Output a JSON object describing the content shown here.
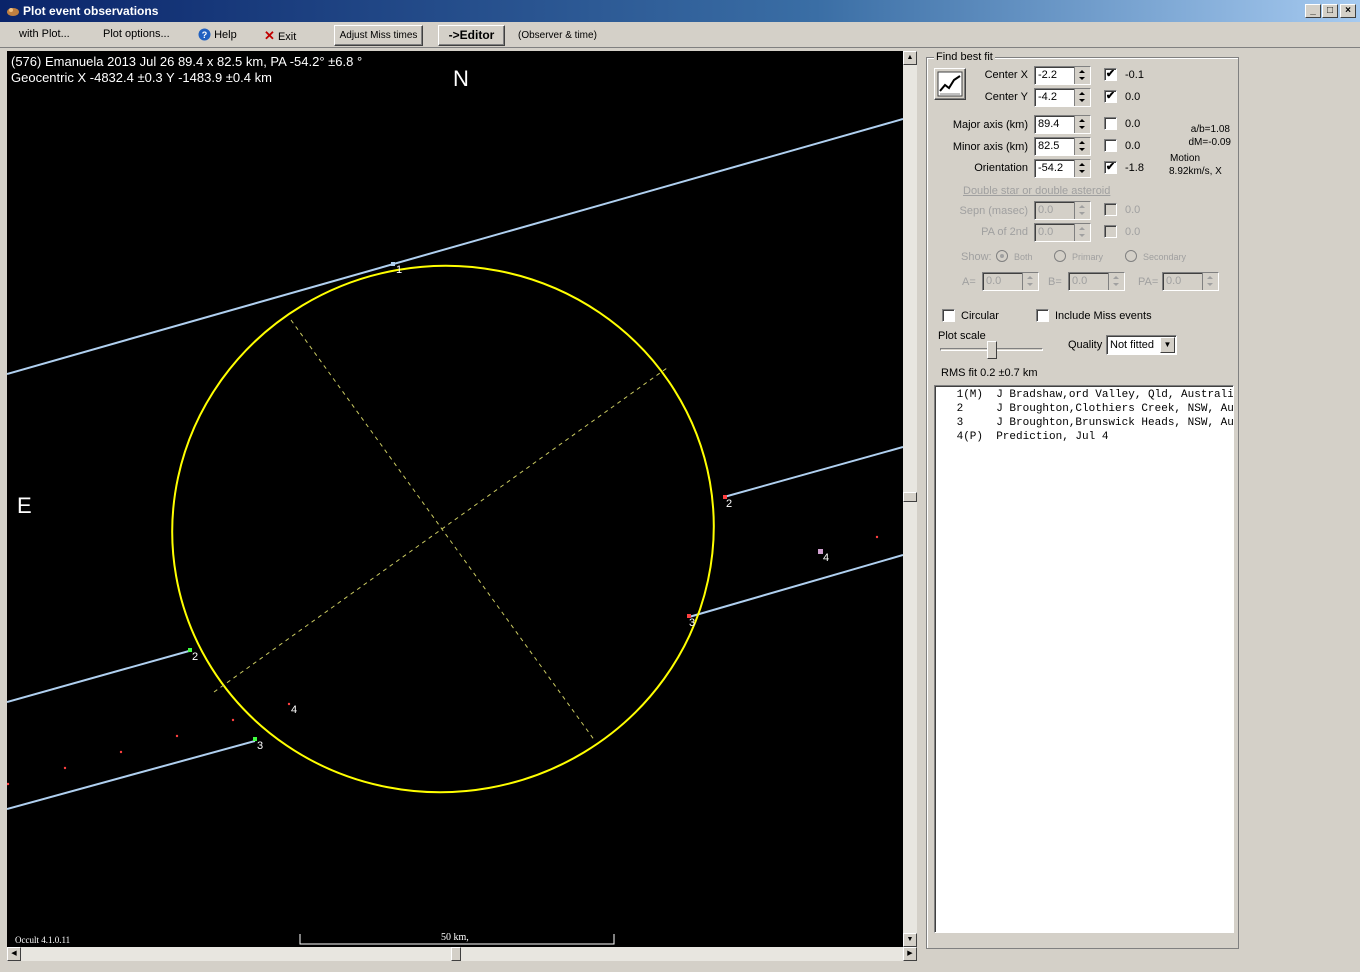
{
  "window": {
    "title": "Plot event observations",
    "min": "_",
    "max": "□",
    "close": "×"
  },
  "menu": {
    "with_plot": "with Plot...",
    "plot_options": "Plot options...",
    "help": "Help",
    "exit": "Exit",
    "adjust_miss": "Adjust Miss times",
    "editor": "->Editor",
    "observer_time": "(Observer & time)"
  },
  "plot": {
    "header1": "(576) Emanuela  2013 Jul 26   89.4 x 82.5 km, PA -54.2° ±6.8 °",
    "header2": "Geocentric X -4832.4 ±0.3  Y -1483.9 ±0.4 km",
    "north": "N",
    "east": "E",
    "version": "Occult 4.1.0.11",
    "scale": "50 km,",
    "chord_labels": [
      "1",
      "2",
      "3",
      "2",
      "3",
      "4",
      "4"
    ]
  },
  "fit": {
    "group_label": "Find best fit",
    "fit_icon": "fit-chart-icon",
    "center_x": {
      "label": "Center X",
      "value": "-2.2",
      "checked": true,
      "delta": "-0.1"
    },
    "center_y": {
      "label": "Center Y",
      "value": "-4.2",
      "checked": true,
      "delta": "0.0"
    },
    "major": {
      "label": "Major axis (km)",
      "value": "89.4",
      "checked": false,
      "delta": "0.0"
    },
    "minor": {
      "label": "Minor axis (km)",
      "value": "82.5",
      "checked": false,
      "delta": "0.0"
    },
    "orientation": {
      "label": "Orientation",
      "value": "-54.2",
      "checked": true,
      "delta": "-1.8"
    },
    "ab_ratio": "a/b=1.08",
    "dm": "dM=-0.09",
    "motion_label": "Motion",
    "motion_value": "8.92km/s, X",
    "double_label": "Double star  or  double asteroid",
    "sepn": {
      "label": "Sepn (masec)",
      "value": "0.0",
      "delta": "0.0"
    },
    "pa2": {
      "label": "PA of 2nd",
      "value": "0.0",
      "delta": "0.0"
    },
    "show_label": "Show:",
    "show_options": [
      "Both",
      "Primary",
      "Secondary"
    ],
    "a_label": "A=",
    "a_value": "0.0",
    "b_label": "B=",
    "b_value": "0.0",
    "pa_label": "PA=",
    "pa_value": "0.0",
    "circular": "Circular",
    "include_miss": "Include Miss events",
    "plot_scale": "Plot scale",
    "quality_label": "Quality",
    "quality_value": "Not fitted",
    "rms": "RMS fit 0.2 ±0.7 km"
  },
  "observers": [
    " 1(M)  J Bradshaw,ord Valley, Qld, Australi",
    " 2     J Broughton,Clothiers Creek, NSW, Au",
    " 3     J Broughton,Brunswick Heads, NSW, Au",
    " 4(P)  Prediction, Jul 4"
  ]
}
